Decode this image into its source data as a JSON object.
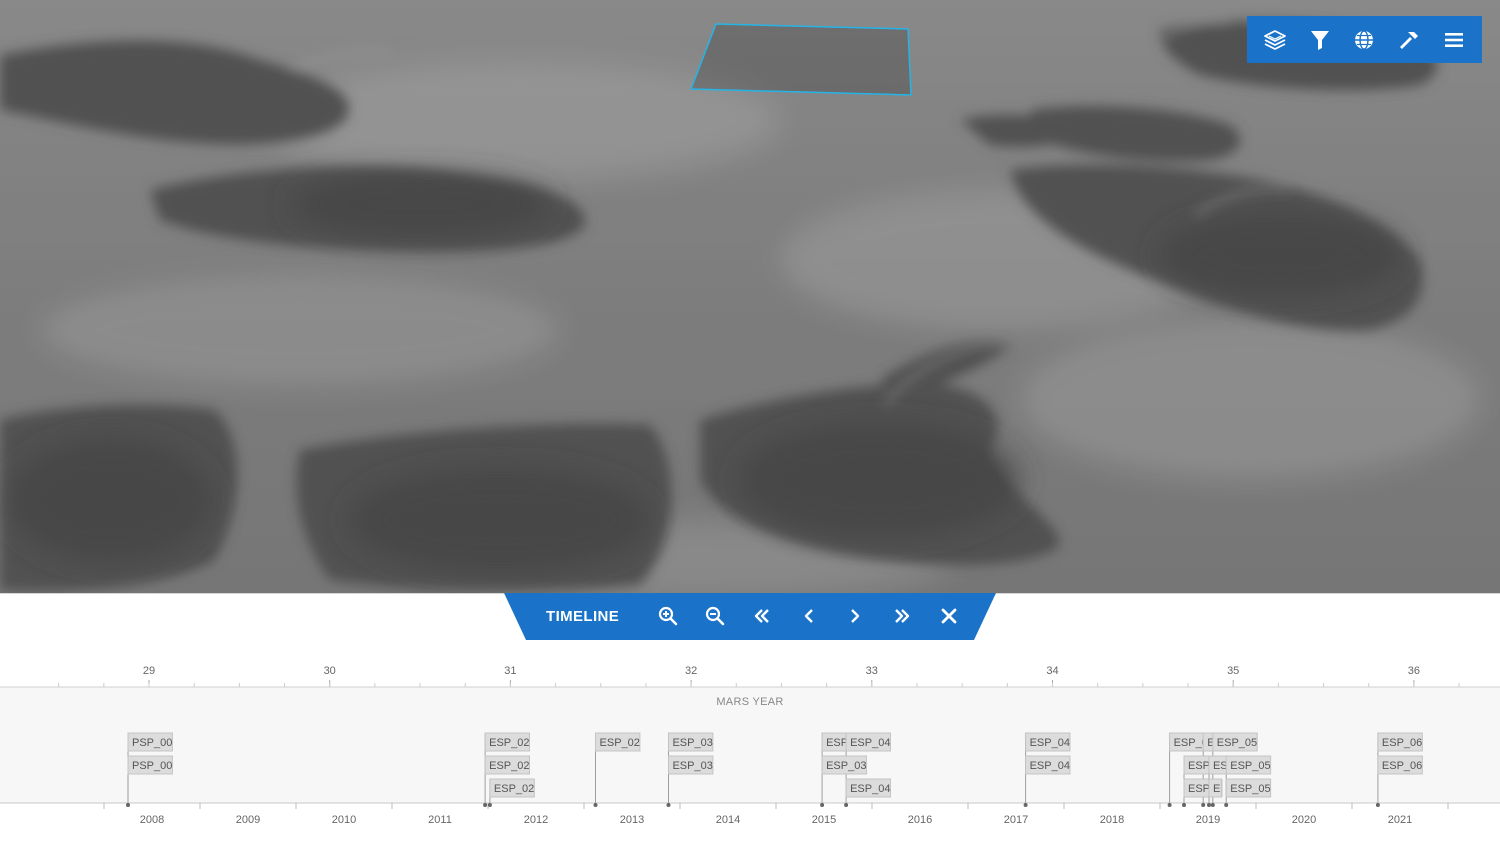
{
  "toolbar": {
    "buttons": [
      {
        "name": "layers-icon",
        "label": "Layers"
      },
      {
        "name": "filter-icon",
        "label": "Filter"
      },
      {
        "name": "globe-icon",
        "label": "Globe"
      },
      {
        "name": "hammer-icon",
        "label": "Tools"
      },
      {
        "name": "menu-icon",
        "label": "Menu"
      }
    ],
    "accent_color": "#1a73c8"
  },
  "timeline": {
    "title": "TIMELINE",
    "controls": [
      {
        "name": "zoom-in-icon"
      },
      {
        "name": "zoom-out-icon"
      },
      {
        "name": "double-chevron-left-icon"
      },
      {
        "name": "chevron-left-icon"
      },
      {
        "name": "chevron-right-icon"
      },
      {
        "name": "double-chevron-right-icon"
      },
      {
        "name": "close-icon"
      }
    ],
    "mars_axis_label": "MARS YEAR",
    "mars_years": [
      "29",
      "30",
      "31",
      "32",
      "33",
      "34",
      "35",
      "36"
    ],
    "earth_years": [
      "2008",
      "2009",
      "2010",
      "2011",
      "2012",
      "2013",
      "2014",
      "2015",
      "2016",
      "2017",
      "2018",
      "2019",
      "2020",
      "2021"
    ],
    "observations": [
      {
        "label": "PSP_00",
        "year": 2007.75,
        "row": 0
      },
      {
        "label": "PSP_00",
        "year": 2007.75,
        "row": 1
      },
      {
        "label": "ESP_02",
        "year": 2011.47,
        "row": 0
      },
      {
        "label": "ESP_02",
        "year": 2011.47,
        "row": 1
      },
      {
        "label": "ESP_02",
        "year": 2011.52,
        "row": 2
      },
      {
        "label": "ESP_02",
        "year": 2012.62,
        "row": 0
      },
      {
        "label": "ESP_03",
        "year": 2013.38,
        "row": 0
      },
      {
        "label": "ESP_03",
        "year": 2013.38,
        "row": 1
      },
      {
        "label": "ESP",
        "year": 2014.98,
        "row": 0
      },
      {
        "label": "ESP_04",
        "year": 2015.23,
        "row": 0
      },
      {
        "label": "ESP_03",
        "year": 2014.98,
        "row": 1
      },
      {
        "label": "ESP_04",
        "year": 2015.23,
        "row": 2
      },
      {
        "label": "ESP_04",
        "year": 2017.1,
        "row": 0
      },
      {
        "label": "ESP_04",
        "year": 2017.1,
        "row": 1
      },
      {
        "label": "ESP_0",
        "year": 2018.6,
        "row": 0
      },
      {
        "label": "E",
        "year": 2018.95,
        "row": 0
      },
      {
        "label": "ESP_05",
        "year": 2019.05,
        "row": 0
      },
      {
        "label": "ESP",
        "year": 2018.75,
        "row": 1
      },
      {
        "label": "ESP",
        "year": 2019.01,
        "row": 1
      },
      {
        "label": "ESP_05",
        "year": 2019.19,
        "row": 1
      },
      {
        "label": "ESP_(",
        "year": 2018.75,
        "row": 2
      },
      {
        "label": "E",
        "year": 2019.01,
        "row": 2
      },
      {
        "label": "ESP_05",
        "year": 2019.19,
        "row": 2
      },
      {
        "label": "ESP_06",
        "year": 2020.77,
        "row": 0
      },
      {
        "label": "ESP_06",
        "year": 2020.77,
        "row": 1
      }
    ]
  }
}
